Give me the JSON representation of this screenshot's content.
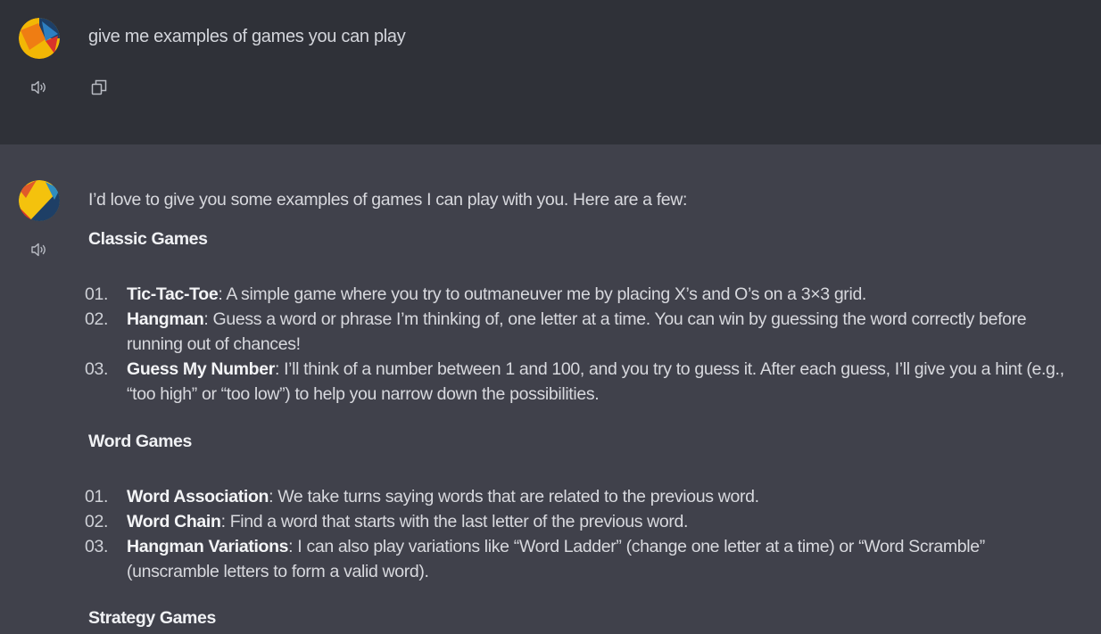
{
  "user_message": {
    "text": "give me examples of games you can play"
  },
  "assistant_message": {
    "intro": "I’d love to give you some examples of games I can play with you. Here are a few:",
    "sections": [
      {
        "heading": "Classic Games",
        "items": [
          {
            "num": "01.",
            "term": "Tic-Tac-Toe",
            "desc": ": A simple game where you try to outmaneuver me by placing X’s and O’s on a 3×3 grid."
          },
          {
            "num": "02.",
            "term": "Hangman",
            "desc": ": Guess a word or phrase I’m thinking of, one letter at a time. You can win by guessing the word correctly before running out of chances!"
          },
          {
            "num": "03.",
            "term": "Guess My Number",
            "desc": ": I’ll think of a number between 1 and 100, and you try to guess it. After each guess, I’ll give you a hint (e.g., “too high” or “too low”) to help you narrow down the possibilities."
          }
        ]
      },
      {
        "heading": "Word Games",
        "items": [
          {
            "num": "01.",
            "term": "Word Association",
            "desc": ": We take turns saying words that are related to the previous word."
          },
          {
            "num": "02.",
            "term": "Word Chain",
            "desc": ": Find a word that starts with the last letter of the previous word."
          },
          {
            "num": "03.",
            "term": "Hangman Variations",
            "desc": ": I can also play variations like “Word Ladder” (change one letter at a time) or “Word Scramble” (unscramble letters to form a valid word)."
          }
        ]
      },
      {
        "heading": "Strategy Games",
        "items": []
      }
    ]
  },
  "icons": {
    "speaker": "speaker-icon",
    "copy": "copy-icon",
    "avatar": "avatar-icon"
  },
  "colors": {
    "user_bg": "#2f3138",
    "assistant_bg": "#40414b",
    "text": "#d8d9de"
  }
}
